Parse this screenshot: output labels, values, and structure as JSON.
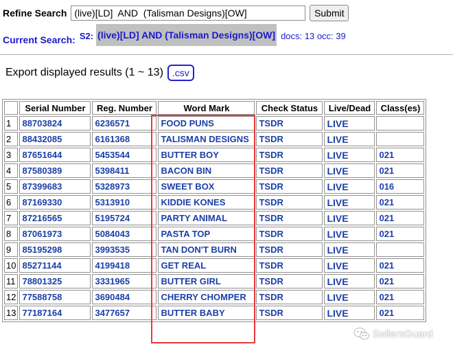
{
  "refine": {
    "label": "Refine Search",
    "query_value": "(live)[LD]  AND  (Talisman Designs)[OW]",
    "submit_label": "Submit"
  },
  "current_search": {
    "label": "Current Search:",
    "tag": "S2:",
    "query": "(live)[LD] AND (Talisman Designs)[OW]",
    "stats": "docs: 13 occ: 39"
  },
  "export": {
    "text": "Export displayed results (1 ~ 13)",
    "csv_label": ".csv"
  },
  "table": {
    "headers": [
      "",
      "Serial Number",
      "Reg. Number",
      "Word Mark",
      "Check Status",
      "Live/Dead",
      "Class(es)"
    ],
    "rows": [
      {
        "n": "1",
        "serial": "88703824",
        "reg": "6236571",
        "mark": "FOOD PUNS",
        "status": "TSDR",
        "live": "LIVE",
        "cls": ""
      },
      {
        "n": "2",
        "serial": "88432085",
        "reg": "6161368",
        "mark": "TALISMAN DESIGNS",
        "status": "TSDR",
        "live": "LIVE",
        "cls": ""
      },
      {
        "n": "3",
        "serial": "87651644",
        "reg": "5453544",
        "mark": "BUTTER BOY",
        "status": "TSDR",
        "live": "LIVE",
        "cls": "021"
      },
      {
        "n": "4",
        "serial": "87580389",
        "reg": "5398411",
        "mark": "BACON BIN",
        "status": "TSDR",
        "live": "LIVE",
        "cls": "021"
      },
      {
        "n": "5",
        "serial": "87399683",
        "reg": "5328973",
        "mark": "SWEET BOX",
        "status": "TSDR",
        "live": "LIVE",
        "cls": "016"
      },
      {
        "n": "6",
        "serial": "87169330",
        "reg": "5313910",
        "mark": "KIDDIE KONES",
        "status": "TSDR",
        "live": "LIVE",
        "cls": "021"
      },
      {
        "n": "7",
        "serial": "87216565",
        "reg": "5195724",
        "mark": "PARTY ANIMAL",
        "status": "TSDR",
        "live": "LIVE",
        "cls": "021"
      },
      {
        "n": "8",
        "serial": "87061973",
        "reg": "5084043",
        "mark": "PASTA TOP",
        "status": "TSDR",
        "live": "LIVE",
        "cls": "021"
      },
      {
        "n": "9",
        "serial": "85195298",
        "reg": "3993535",
        "mark": "TAN DON'T BURN",
        "status": "TSDR",
        "live": "LIVE",
        "cls": ""
      },
      {
        "n": "10",
        "serial": "85271144",
        "reg": "4199418",
        "mark": "GET REAL",
        "status": "TSDR",
        "live": "LIVE",
        "cls": "021"
      },
      {
        "n": "11",
        "serial": "78801325",
        "reg": "3331965",
        "mark": "BUTTER GIRL",
        "status": "TSDR",
        "live": "LIVE",
        "cls": "021"
      },
      {
        "n": "12",
        "serial": "77588758",
        "reg": "3690484",
        "mark": "CHERRY CHOMPER",
        "status": "TSDR",
        "live": "LIVE",
        "cls": "021"
      },
      {
        "n": "13",
        "serial": "77187164",
        "reg": "3477657",
        "mark": "BUTTER BABY",
        "status": "TSDR",
        "live": "LIVE",
        "cls": "021"
      }
    ]
  },
  "watermark": {
    "text": "SellersGuard",
    "icon": "wechat-icon"
  },
  "colors": {
    "link_blue": "#1a3fa8",
    "highlight_red": "#e8393a",
    "query_bg": "#c0c0c0"
  }
}
